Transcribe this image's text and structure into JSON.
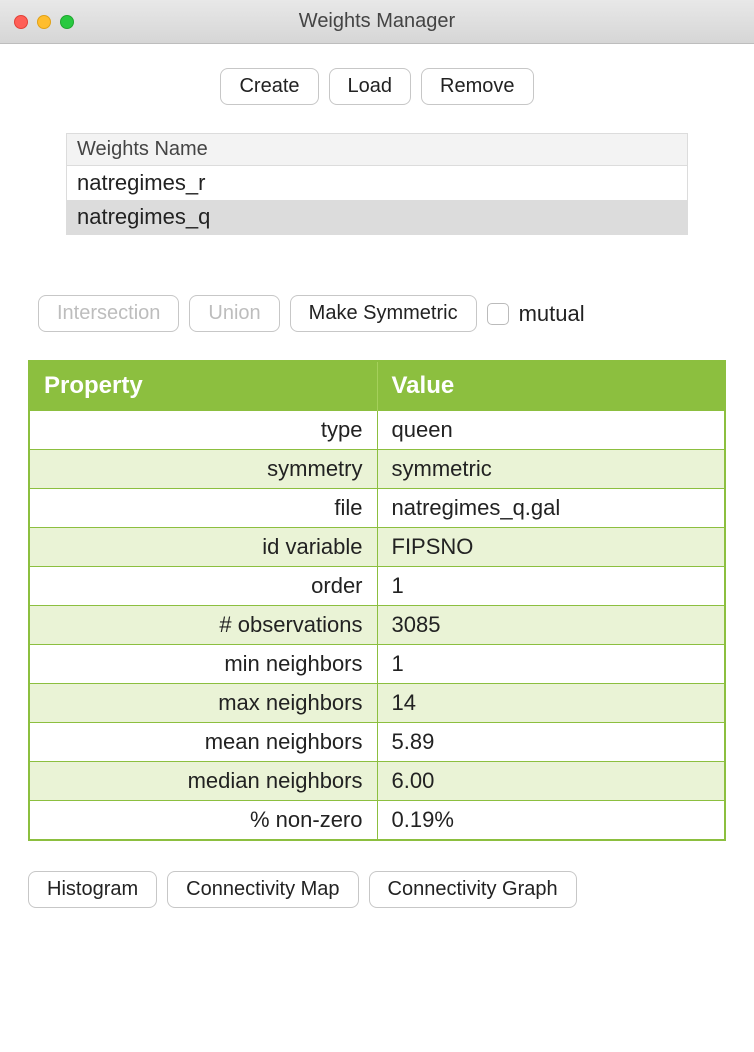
{
  "window": {
    "title": "Weights Manager"
  },
  "toolbar": {
    "create": "Create",
    "load": "Load",
    "remove": "Remove"
  },
  "weights": {
    "header": "Weights Name",
    "items": [
      {
        "name": "natregimes_r",
        "selected": false
      },
      {
        "name": "natregimes_q",
        "selected": true
      }
    ]
  },
  "ops": {
    "intersection": "Intersection",
    "union": "Union",
    "make_symmetric": "Make Symmetric",
    "mutual": "mutual"
  },
  "prop_table": {
    "headers": {
      "property": "Property",
      "value": "Value"
    },
    "rows": [
      {
        "key": "type",
        "val": "queen"
      },
      {
        "key": "symmetry",
        "val": "symmetric"
      },
      {
        "key": "file",
        "val": "natregimes_q.gal"
      },
      {
        "key": "id variable",
        "val": "FIPSNO"
      },
      {
        "key": "order",
        "val": "1"
      },
      {
        "key": "# observations",
        "val": "3085"
      },
      {
        "key": "min neighbors",
        "val": "1"
      },
      {
        "key": "max neighbors",
        "val": "14"
      },
      {
        "key": "mean neighbors",
        "val": "5.89"
      },
      {
        "key": "median neighbors",
        "val": "6.00"
      },
      {
        "key": "% non-zero",
        "val": "0.19%"
      }
    ]
  },
  "bottom": {
    "histogram": "Histogram",
    "conn_map": "Connectivity Map",
    "conn_graph": "Connectivity Graph"
  }
}
